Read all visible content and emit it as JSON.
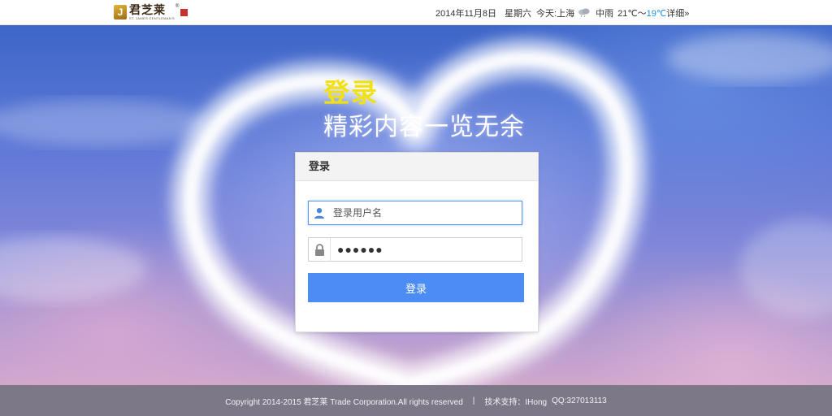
{
  "header": {
    "logo_text": "君芝莱",
    "logo_en": "ST. JAMES GENTLEMAN'S",
    "logo_reg": "®",
    "weather": {
      "date": "2014年11月8日",
      "weekday": "星期六",
      "today_label": "今天:",
      "city": "上海",
      "condition": "中雨",
      "temp_high": "21℃",
      "separator": "～",
      "temp_low": "19℃",
      "detail_link": "详细»",
      "icon": "rain-cloud-icon"
    }
  },
  "hero": {
    "title": "登录",
    "subtitle": "精彩内容一览无余"
  },
  "login": {
    "header": "登录",
    "username_placeholder": "登录用户名",
    "password_mask": "●●●●●●",
    "button_label": "登录",
    "user_icon": "user-icon",
    "lock_icon": "lock-icon"
  },
  "footer": {
    "copyright": "Copyright 2014-2015 君芝莱  Trade Corporation.All rights reserved",
    "separator": "|",
    "support_label": "技术支持：IHong",
    "qq": "QQ:327013113"
  },
  "colors": {
    "title_yellow": "#f1e012",
    "button_blue": "#4c8cf5",
    "temp_low": "#1f8fd6"
  }
}
